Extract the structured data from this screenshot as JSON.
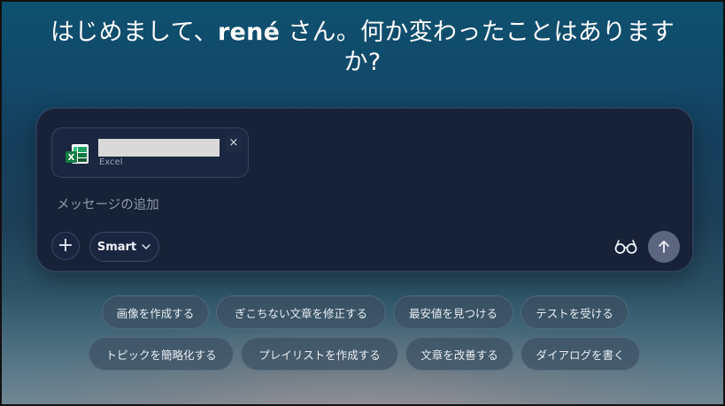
{
  "greeting": {
    "prefix": "はじめまして、",
    "name": "rené",
    "suffix": " さん。何か変わったことはありますか?"
  },
  "attachment": {
    "type_label": "Excel",
    "icon": "excel-icon",
    "remove_label": "×"
  },
  "composer": {
    "placeholder": "メッセージの追加",
    "add_label": "+",
    "mode_label": "Smart",
    "glasses_icon": "glasses-icon",
    "send_icon": "arrow-up-icon"
  },
  "suggestions": {
    "row1": [
      "画像を作成する",
      "ぎこちない文章を修正する",
      "最安値を見つける",
      "テストを受ける"
    ],
    "row2": [
      "トピックを簡略化する",
      "プレイリストを作成する",
      "文章を改善する",
      "ダイアログを書く"
    ]
  },
  "colors": {
    "composer_bg": "#172238",
    "send_button": "#5d6680",
    "excel_green": "#1f8a4c"
  }
}
